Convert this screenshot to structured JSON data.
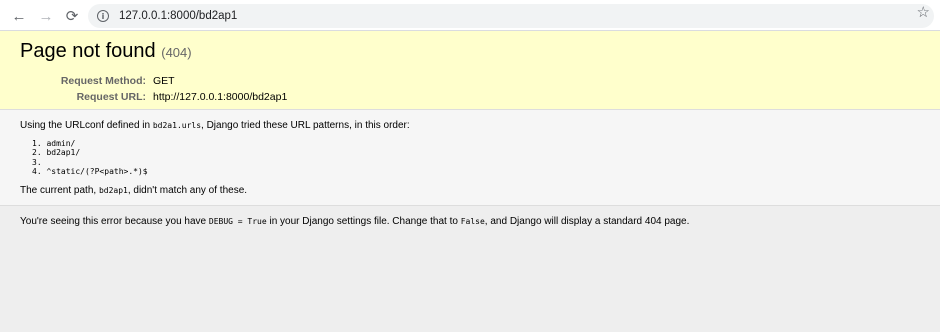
{
  "browser": {
    "url": "127.0.0.1:8000/bd2ap1",
    "icons": {
      "back": "arrow-left-icon",
      "forward": "arrow-right-icon",
      "reload": "reload-icon",
      "info": "info-icon",
      "bookmark": "star-icon"
    }
  },
  "error": {
    "title": "Page not found",
    "code": "(404)",
    "meta": [
      {
        "label": "Request Method:",
        "value": "GET"
      },
      {
        "label": "Request URL:",
        "value": "http://127.0.0.1:8000/bd2ap1"
      }
    ]
  },
  "info": {
    "intro_prefix": "Using the URLconf defined in ",
    "urlconf": "bd2a1.urls",
    "intro_suffix": ", Django tried these URL patterns, in this order:",
    "patterns": [
      "1. admin/",
      "2. bd2ap1/",
      "3.",
      "4. ^static/(?P<path>.*)$"
    ],
    "current_prefix": "The current path, ",
    "current_path": "bd2ap1",
    "current_suffix": ", didn't match any of these."
  },
  "explanation": {
    "prefix": "You're seeing this error because you have ",
    "debug_setting": "DEBUG = True",
    "middle": " in your Django settings file. Change that to ",
    "false_value": "False",
    "suffix": ", and Django will display a standard 404 page."
  },
  "colors": {
    "summary_bg": "#ffffcc",
    "info_bg": "#f6f6f6",
    "explanation_bg": "#eeeeee"
  }
}
